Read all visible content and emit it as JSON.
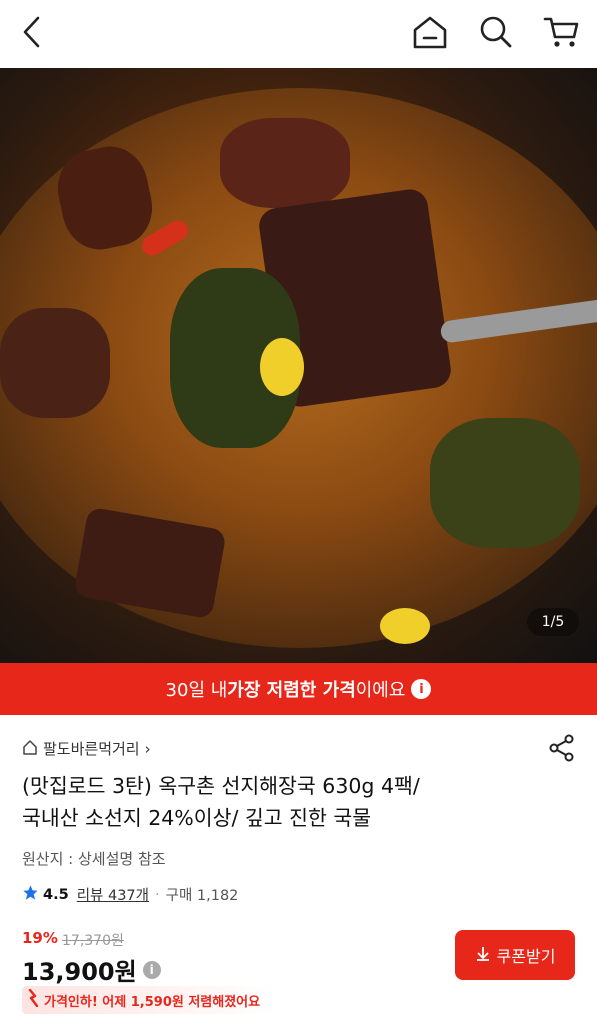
{
  "header": {
    "back_icon": "chevron-left-icon",
    "home_icon": "home-icon",
    "search_icon": "search-icon",
    "cart_icon": "cart-icon"
  },
  "gallery": {
    "counter": "1/5"
  },
  "banner": {
    "text_pre": "30일 내 ",
    "text_bold": "가장 저렴한 가격",
    "text_post": "이에요",
    "info_glyph": "i",
    "color": "#e8271b"
  },
  "store": {
    "name": "팔도바른먹거리",
    "arrow": "›"
  },
  "product": {
    "title_line1": "(맛집로드 3탄) 옥구촌 선지해장국 630g 4팩/",
    "title_line2": "국내산 소선지 24%이상/ 깊고 진한 국물",
    "origin": "원산지 : 상세설명 참조"
  },
  "rating": {
    "score": "4.5",
    "reviews": "리뷰 437개",
    "separator": "·",
    "purchases": "구매 1,182"
  },
  "price": {
    "discount": "19%",
    "original": "17,370원",
    "current": "13,900원",
    "info_glyph": "i"
  },
  "coupon_button": {
    "label": "쿠폰받기",
    "icon": "download-arrow-icon"
  },
  "price_drop": {
    "text": "가격인하! 어제 1,590원 저렴해졌어요",
    "icon": "down-trend-icon"
  }
}
